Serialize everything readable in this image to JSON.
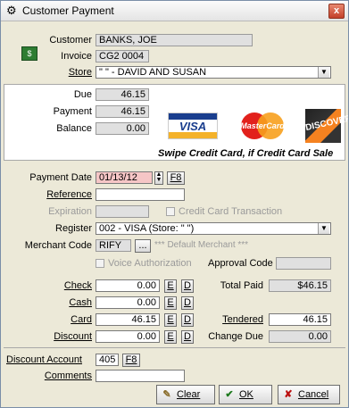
{
  "window": {
    "title": "Customer Payment",
    "close": "x"
  },
  "customer": {
    "label": "Customer",
    "value": "BANKS, JOE"
  },
  "invoice": {
    "label": "Invoice",
    "value": "CG2 0004"
  },
  "store": {
    "label": "Store",
    "value": "\" \" - DAVID AND SUSAN"
  },
  "summary": {
    "due_label": "Due",
    "due": "46.15",
    "payment_label": "Payment",
    "payment": "46.15",
    "balance_label": "Balance",
    "balance": "0.00"
  },
  "logos": {
    "visa": "VISA",
    "mastercard": "MasterCard",
    "discover": "DISCOVER"
  },
  "swipe_text": "Swipe Credit Card, if Credit Card Sale",
  "payment_date": {
    "label": "Payment Date",
    "value": "01/13/12",
    "f8": "F8"
  },
  "reference": {
    "label": "Reference",
    "value": ""
  },
  "expiration": {
    "label": "Expiration",
    "value": "",
    "cc_label": "Credit Card Transaction"
  },
  "register": {
    "label": "Register",
    "value": "002 - VISA (Store: \" \")"
  },
  "merchant": {
    "label": "Merchant Code",
    "value": "RIFY",
    "browse": "...",
    "note": "*** Default Merchant ***"
  },
  "voice_auth": {
    "label": "Voice Authorization"
  },
  "approval": {
    "label": "Approval Code",
    "value": ""
  },
  "tenders": {
    "check_label": "Check",
    "check": "0.00",
    "cash_label": "Cash",
    "cash": "0.00",
    "card_label": "Card",
    "card": "46.15",
    "discount_label": "Discount",
    "discount": "0.00",
    "e": "E",
    "d": "D"
  },
  "totals": {
    "total_paid_label": "Total Paid",
    "total_paid": "$46.15",
    "tendered_label": "Tendered",
    "tendered": "46.15",
    "change_label": "Change Due",
    "change": "0.00"
  },
  "discount_account": {
    "label": "Discount Account",
    "value": "405",
    "f8": "F8"
  },
  "comments": {
    "label": "Comments",
    "value": ""
  },
  "buttons": {
    "clear": "Clear",
    "ok": "OK",
    "cancel": "Cancel"
  },
  "colors": {
    "pink_field": "#f6c6c6",
    "readonly": "#e0e0e0",
    "accent": "#1a3e8e"
  }
}
